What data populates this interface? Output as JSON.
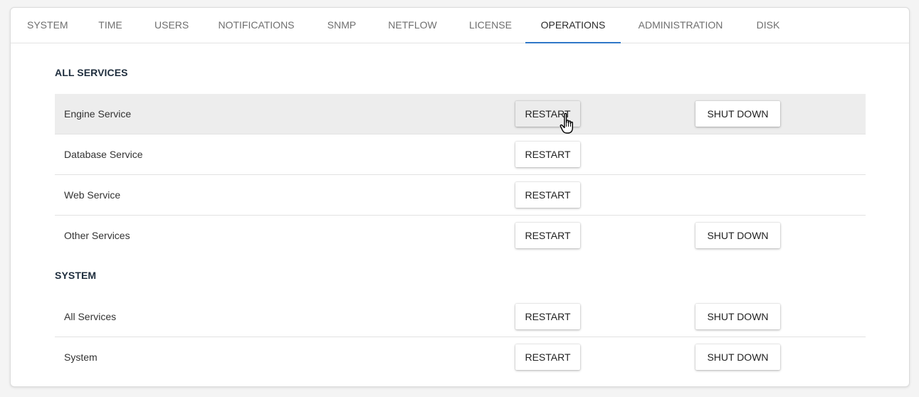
{
  "tabs": [
    {
      "label": "SYSTEM"
    },
    {
      "label": "TIME"
    },
    {
      "label": "USERS"
    },
    {
      "label": "NOTIFICATIONS"
    },
    {
      "label": "SNMP"
    },
    {
      "label": "NETFLOW"
    },
    {
      "label": "LICENSE"
    },
    {
      "label": "OPERATIONS",
      "active": true
    },
    {
      "label": "ADMINISTRATION"
    },
    {
      "label": "DISK"
    }
  ],
  "sections": {
    "all_services": {
      "title": "ALL SERVICES",
      "rows": [
        {
          "label": "Engine Service",
          "restart": "RESTART",
          "shutdown": "SHUT DOWN"
        },
        {
          "label": "Database Service",
          "restart": "RESTART"
        },
        {
          "label": "Web Service",
          "restart": "RESTART"
        },
        {
          "label": "Other Services",
          "restart": "RESTART",
          "shutdown": "SHUT DOWN"
        }
      ]
    },
    "system": {
      "title": "SYSTEM",
      "rows": [
        {
          "label": "All Services",
          "restart": "RESTART",
          "shutdown": "SHUT DOWN"
        },
        {
          "label": "System",
          "restart": "RESTART",
          "shutdown": "SHUT DOWN"
        }
      ]
    }
  },
  "cursor": {
    "icon": "hand-pointer-icon"
  },
  "colors": {
    "active_tab_underline": "#2f77c8",
    "hover_row": "#ededed"
  }
}
